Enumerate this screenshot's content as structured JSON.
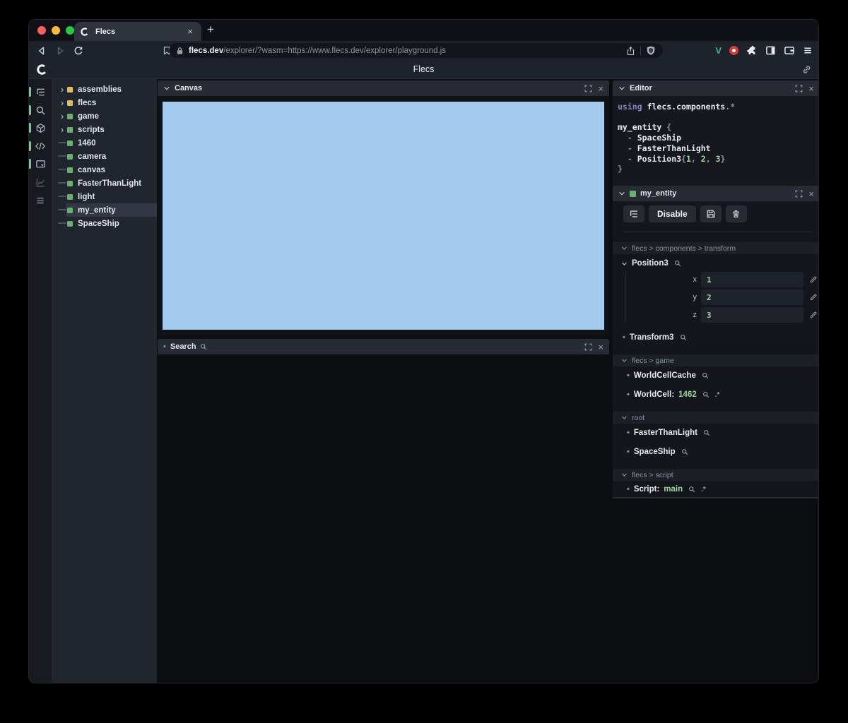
{
  "colors": {
    "entity_green": "#67b36e",
    "module_yellow": "#dec04e",
    "value_green": "#98d79c",
    "canvas_blue": "#a3cbef",
    "keyword_purple": "#8484c4",
    "extension_v_green": "#42b983"
  },
  "browser": {
    "tab_title": "Flecs",
    "close_icon": "×",
    "new_tab_icon": "+",
    "url_domain": "flecs.dev",
    "url_path": "/explorer/?wasm=https://www.flecs.dev/explorer/playground.js",
    "extension_v_label": "V"
  },
  "header": {
    "title": "Flecs"
  },
  "glyphs": {
    "expand_arrow": "›",
    "leaf_dash": "—",
    "bullet": "•",
    "pair_suffix": ".*"
  },
  "tree": {
    "items": [
      {
        "label": "assemblies",
        "color": "#dec04e"
      },
      {
        "label": "flecs",
        "color": "#dec04e"
      },
      {
        "label": "game",
        "color": "#67b36e"
      },
      {
        "label": "scripts",
        "color": "#67b36e"
      },
      {
        "label": "1460",
        "color": "#67b36e"
      },
      {
        "label": "camera",
        "color": "#67b36e"
      },
      {
        "label": "canvas",
        "color": "#67b36e"
      },
      {
        "label": "FasterThanLight",
        "color": "#67b36e"
      },
      {
        "label": "light",
        "color": "#67b36e"
      },
      {
        "label": "my_entity",
        "color": "#5fb368"
      },
      {
        "label": "SpaceShip",
        "color": "#67b36e"
      }
    ]
  },
  "canvas_panel": {
    "title": "Canvas",
    "color": "#a3cbef"
  },
  "search_panel": {
    "title": "Search"
  },
  "editor": {
    "title": "Editor",
    "code": {
      "kw_using": "using",
      "using_path": "flecs.components",
      "dot": ".",
      "star": "*",
      "entity_name": "my_entity",
      "open_brace": "{",
      "close_brace": "}",
      "dash": "-",
      "tag1": "SpaceShip",
      "tag2": "FasterThanLight",
      "comp_name": "Position3",
      "n1": "1",
      "n2": "2",
      "n3": "3",
      "comma": ", "
    }
  },
  "inspector": {
    "title": "my_entity",
    "disable_label": "Disable",
    "transform_path": "flecs > components > transform",
    "position3": "Position3",
    "fields": [
      {
        "name": "x",
        "value": "1"
      },
      {
        "name": "y",
        "value": "2"
      },
      {
        "name": "z",
        "value": "3"
      }
    ],
    "transform3": "Transform3",
    "game_path": "flecs > game",
    "worldcellcache": "WorldCellCache",
    "worldcell_label": "WorldCell:",
    "worldcell_value": "1462",
    "root_path": "root",
    "fasterthanlight": "FasterThanLight",
    "spaceship": "SpaceShip",
    "script_path": "flecs > script",
    "script_label": "Script:",
    "script_value": "main"
  }
}
